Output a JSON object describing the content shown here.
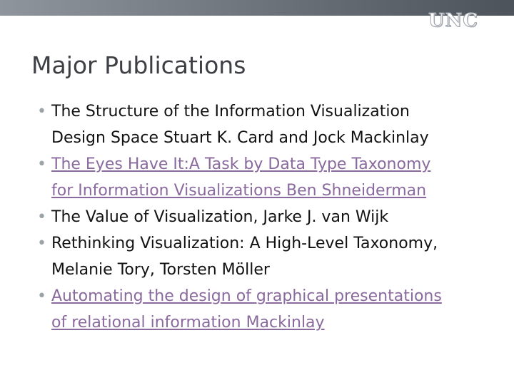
{
  "header": {
    "logo_text": "UNC",
    "bar_color": "#6e747c"
  },
  "title": "Major Publications",
  "bullets": [
    {
      "lines": [
        "The Structure of the Information Visualization",
        "Design Space Stuart K. Card and Jock Mackinlay"
      ],
      "is_link": false
    },
    {
      "lines": [
        "The Eyes Have It:A Task by Data Type Taxonomy",
        "for Information Visualizations Ben Shneiderman"
      ],
      "is_link": true
    },
    {
      "lines": [
        "The Value of Visualization, Jarke J. van Wijk"
      ],
      "is_link": false
    },
    {
      "lines": [
        "Rethinking Visualization: A High-Level Taxonomy,",
        "Melanie Tory, Torsten Möller"
      ],
      "is_link": false
    },
    {
      "lines": [
        "Automating the design of graphical presentations",
        "of relational information Mackinlay"
      ],
      "is_link": true
    }
  ],
  "colors": {
    "link": "#8a6a9e",
    "text": "#111111",
    "title": "#3d3f44",
    "bullet": "#9aa4a8"
  }
}
